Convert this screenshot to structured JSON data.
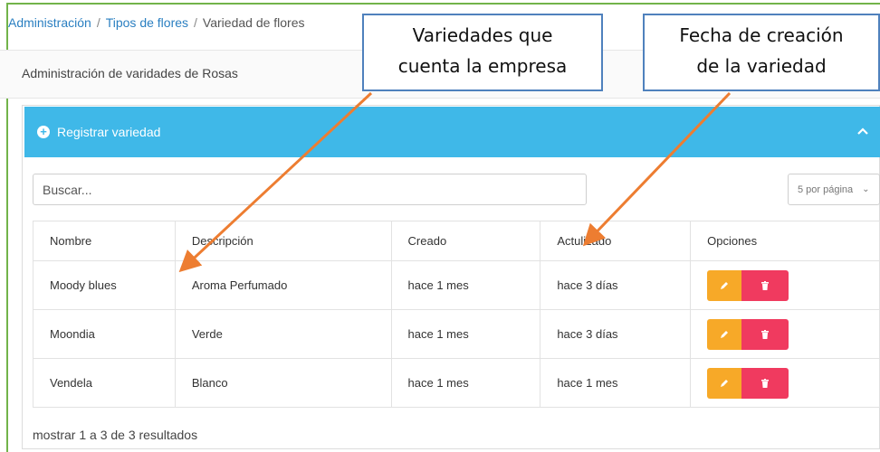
{
  "breadcrumb": {
    "items": [
      "Administración",
      "Tipos de flores",
      "Variedad de flores"
    ],
    "separator": "/"
  },
  "page": {
    "title": "Administración de varidades de Rosas"
  },
  "panel": {
    "title": "Registrar variedad",
    "header_color": "#3fb8e8"
  },
  "search": {
    "placeholder": "Buscar..."
  },
  "pagination": {
    "per_page": "5 por página"
  },
  "table": {
    "headers": [
      "Nombre",
      "Descripción",
      "Creado",
      "Actulizado",
      "Opciones"
    ],
    "rows": [
      {
        "nombre": "Moody blues",
        "descripcion": "Aroma Perfumado",
        "creado": "hace 1 mes",
        "actualizado": "hace 3 días"
      },
      {
        "nombre": "Moondia",
        "descripcion": "Verde",
        "creado": "hace 1 mes",
        "actualizado": "hace 3 días"
      },
      {
        "nombre": "Vendela",
        "descripcion": "Blanco",
        "creado": "hace 1 mes",
        "actualizado": "hace 1 mes"
      }
    ]
  },
  "footer": {
    "summary": "mostrar 1 a 3 de 3 resultados"
  },
  "annotations": {
    "callout_1_line1": "Variedades que",
    "callout_1_line2": "cuenta la empresa",
    "callout_2_line1": "Fecha de creación",
    "callout_2_line2": "de la variedad",
    "arrow_color": "#ed7d31",
    "border_color": "#4f81bd"
  },
  "colors": {
    "edit": "#f7a928",
    "delete": "#f03a5f",
    "link": "#2a7fc1"
  },
  "icons": [
    "plus-circle-icon",
    "chevron-up-icon",
    "chevron-down-icon",
    "pencil-icon",
    "trash-icon"
  ]
}
